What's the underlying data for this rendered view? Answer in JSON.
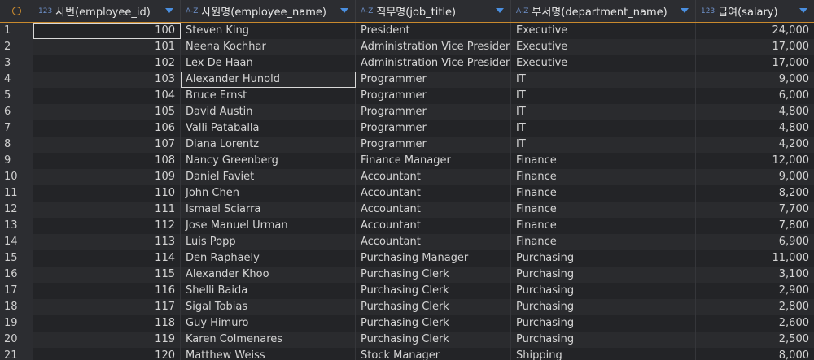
{
  "columns": [
    {
      "type": "123",
      "label": "사번(employee_id)"
    },
    {
      "type": "A-Z",
      "label": "사원명(employee_name)"
    },
    {
      "type": "A-Z",
      "label": "직무명(job_title)"
    },
    {
      "type": "A-Z",
      "label": "부서명(department_name)"
    },
    {
      "type": "123",
      "label": "급여(salary)"
    }
  ],
  "rows": [
    {
      "n": "1",
      "id": "100",
      "name": "Steven King",
      "job": "President",
      "dept": "Executive",
      "salary": "24,000"
    },
    {
      "n": "2",
      "id": "101",
      "name": "Neena Kochhar",
      "job": "Administration Vice President",
      "dept": "Executive",
      "salary": "17,000"
    },
    {
      "n": "3",
      "id": "102",
      "name": "Lex De Haan",
      "job": "Administration Vice President",
      "dept": "Executive",
      "salary": "17,000"
    },
    {
      "n": "4",
      "id": "103",
      "name": "Alexander Hunold",
      "job": "Programmer",
      "dept": "IT",
      "salary": "9,000"
    },
    {
      "n": "5",
      "id": "104",
      "name": "Bruce Ernst",
      "job": "Programmer",
      "dept": "IT",
      "salary": "6,000"
    },
    {
      "n": "6",
      "id": "105",
      "name": "David Austin",
      "job": "Programmer",
      "dept": "IT",
      "salary": "4,800"
    },
    {
      "n": "7",
      "id": "106",
      "name": "Valli Pataballa",
      "job": "Programmer",
      "dept": "IT",
      "salary": "4,800"
    },
    {
      "n": "8",
      "id": "107",
      "name": "Diana Lorentz",
      "job": "Programmer",
      "dept": "IT",
      "salary": "4,200"
    },
    {
      "n": "9",
      "id": "108",
      "name": "Nancy Greenberg",
      "job": "Finance Manager",
      "dept": "Finance",
      "salary": "12,000"
    },
    {
      "n": "10",
      "id": "109",
      "name": "Daniel Faviet",
      "job": "Accountant",
      "dept": "Finance",
      "salary": "9,000"
    },
    {
      "n": "11",
      "id": "110",
      "name": "John Chen",
      "job": "Accountant",
      "dept": "Finance",
      "salary": "8,200"
    },
    {
      "n": "12",
      "id": "111",
      "name": "Ismael Sciarra",
      "job": "Accountant",
      "dept": "Finance",
      "salary": "7,700"
    },
    {
      "n": "13",
      "id": "112",
      "name": "Jose Manuel Urman",
      "job": "Accountant",
      "dept": "Finance",
      "salary": "7,800"
    },
    {
      "n": "14",
      "id": "113",
      "name": "Luis Popp",
      "job": "Accountant",
      "dept": "Finance",
      "salary": "6,900"
    },
    {
      "n": "15",
      "id": "114",
      "name": "Den Raphaely",
      "job": "Purchasing Manager",
      "dept": "Purchasing",
      "salary": "11,000"
    },
    {
      "n": "16",
      "id": "115",
      "name": "Alexander Khoo",
      "job": "Purchasing Clerk",
      "dept": "Purchasing",
      "salary": "3,100"
    },
    {
      "n": "17",
      "id": "116",
      "name": "Shelli Baida",
      "job": "Purchasing Clerk",
      "dept": "Purchasing",
      "salary": "2,900"
    },
    {
      "n": "18",
      "id": "117",
      "name": "Sigal Tobias",
      "job": "Purchasing Clerk",
      "dept": "Purchasing",
      "salary": "2,800"
    },
    {
      "n": "19",
      "id": "118",
      "name": "Guy Himuro",
      "job": "Purchasing Clerk",
      "dept": "Purchasing",
      "salary": "2,600"
    },
    {
      "n": "20",
      "id": "119",
      "name": "Karen Colmenares",
      "job": "Purchasing Clerk",
      "dept": "Purchasing",
      "salary": "2,500"
    },
    {
      "n": "21",
      "id": "120",
      "name": "Matthew Weiss",
      "job": "Stock Manager",
      "dept": "Shipping",
      "salary": "8,000"
    }
  ]
}
